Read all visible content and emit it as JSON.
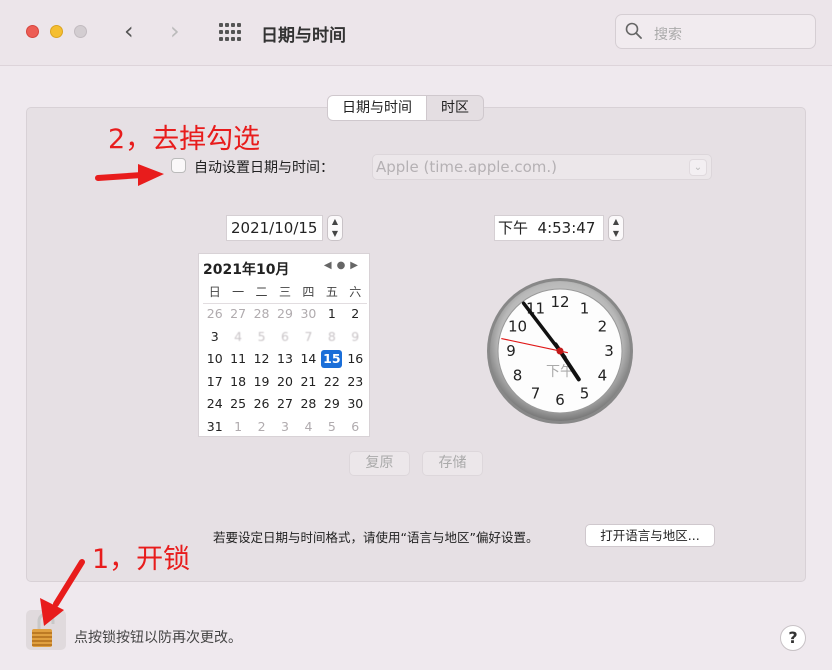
{
  "window": {
    "title": "日期与时间",
    "search_placeholder": "搜索"
  },
  "tabs": [
    {
      "label": "日期与时间",
      "active": true
    },
    {
      "label": "时区",
      "active": false
    }
  ],
  "auto_set": {
    "checked": false,
    "label": "自动设置日期与时间：",
    "server": "Apple (time.apple.com.)"
  },
  "date_field": "2021/10/15",
  "time_field": "下午  4:53:47",
  "calendar": {
    "header": "2021年10月",
    "nav": "◀●▶",
    "weekdays": [
      "日",
      "一",
      "二",
      "三",
      "四",
      "五",
      "六"
    ],
    "rows": [
      [
        "26",
        "27",
        "28",
        "29",
        "30",
        "1",
        "2"
      ],
      [
        "3",
        "4",
        "5",
        "6",
        "7",
        "8",
        "9"
      ],
      [
        "10",
        "11",
        "12",
        "13",
        "14",
        "15",
        "16"
      ],
      [
        "17",
        "18",
        "19",
        "20",
        "21",
        "22",
        "23"
      ],
      [
        "24",
        "25",
        "26",
        "27",
        "28",
        "29",
        "30"
      ],
      [
        "31",
        "1",
        "2",
        "3",
        "4",
        "5",
        "6"
      ]
    ],
    "selected": "15"
  },
  "clock": {
    "numbers": [
      "12",
      "1",
      "2",
      "3",
      "4",
      "5",
      "6",
      "7",
      "8",
      "9",
      "10",
      "11"
    ],
    "meridiem": "下午",
    "hour": 4,
    "minute": 53,
    "second": 47
  },
  "buttons": {
    "revert": "复原",
    "save": "存储",
    "open_language": "打开语言与地区..."
  },
  "format_note": "若要设定日期与时间格式，请使用“语言与地区”偏好设置。",
  "lock_note": "点按锁按钮以防再次更改。",
  "help": "?",
  "annotations": {
    "step2": "2，去掉勾选",
    "step1": "1，开锁"
  },
  "colors": {
    "accent": "#1a6ed8",
    "annotation": "#e81c1c"
  }
}
